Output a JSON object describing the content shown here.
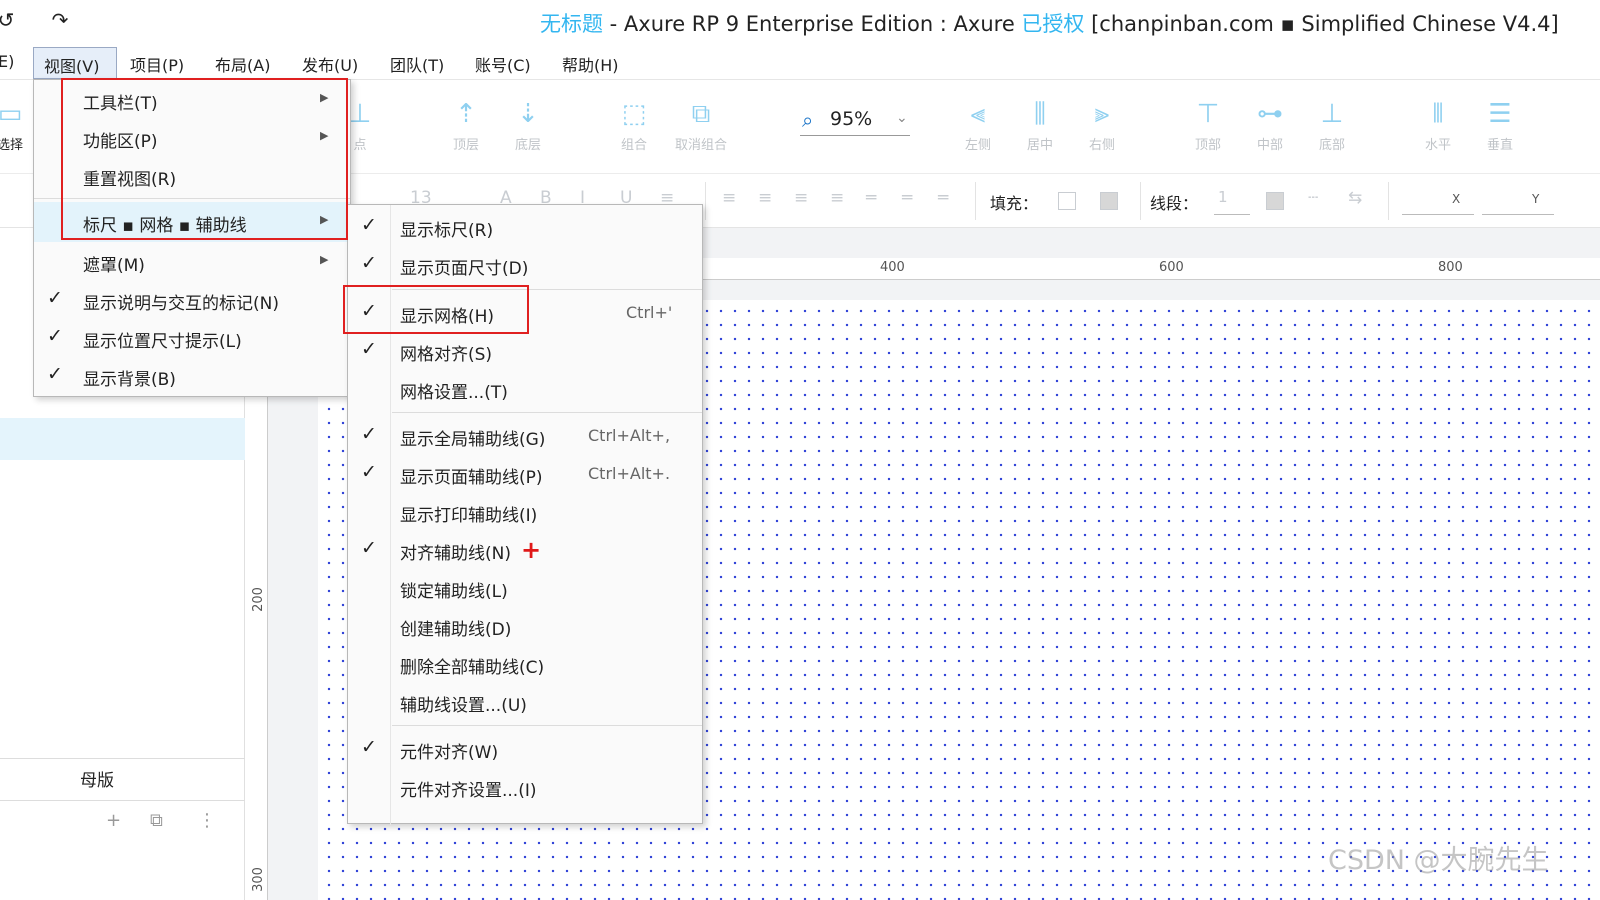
{
  "titlebar": {
    "undo_icon": "undo-icon",
    "redo_icon": "redo-icon",
    "title_name": "无标题",
    "title_mid": " - Axure RP 9 Enterprise Edition : Axure ",
    "title_licensed": "已授权",
    "title_tail": " [chanpinban.com ▪ Simplified Chinese V4.4]",
    "accent_color": "#33b6f0"
  },
  "menubar": {
    "edit_partial": "E)",
    "view": "视图(V)",
    "project": "项目(P)",
    "layout": "布局(A)",
    "publish": "发布(U)",
    "team": "团队(T)",
    "account": "账号(C)",
    "help": "帮助(H)"
  },
  "toolbar": {
    "select_label": "选择",
    "end_label": "点",
    "top_layer": "顶层",
    "bottom_layer": "底层",
    "group": "组合",
    "ungroup": "取消组合",
    "zoom_value": "95%",
    "align_left": "左侧",
    "align_center": "居中",
    "align_right": "右侧",
    "align_top": "顶部",
    "align_middle": "中部",
    "align_bottom": "底部",
    "distribute_h": "水平",
    "distribute_v": "垂直"
  },
  "stylebar": {
    "font_size": "13",
    "fill_label": "填充：",
    "stroke_label": "线段：",
    "stroke_value": "1",
    "x_label": "X",
    "y_label": "Y"
  },
  "leftpanel": {
    "masters_label": "母版"
  },
  "rulers": {
    "h400": "400",
    "h600": "600",
    "h800": "800",
    "v200": "200",
    "v300": "300"
  },
  "view_menu": {
    "items": [
      {
        "label": "工具栏(T)",
        "checked": false,
        "submenu": true
      },
      {
        "label": "功能区(P)",
        "checked": false,
        "submenu": true
      },
      {
        "label": "重置视图(R)",
        "checked": false,
        "submenu": false
      },
      {
        "label": "标尺 ▪ 网格 ▪ 辅助线",
        "checked": false,
        "submenu": true
      },
      {
        "label": "遮罩(M)",
        "checked": false,
        "submenu": true
      },
      {
        "label": "显示说明与交互的标记(N)",
        "checked": true,
        "submenu": false
      },
      {
        "label": "显示位置尺寸提示(L)",
        "checked": true,
        "submenu": false
      },
      {
        "label": "显示背景(B)",
        "checked": true,
        "submenu": false
      }
    ]
  },
  "grid_submenu": {
    "items": [
      {
        "label": "显示标尺(R)",
        "checked": true,
        "shortcut": ""
      },
      {
        "label": "显示页面尺寸(D)",
        "checked": true,
        "shortcut": ""
      },
      {
        "label": "显示网格(H)",
        "checked": true,
        "shortcut": "Ctrl+'"
      },
      {
        "label": "网格对齐(S)",
        "checked": true,
        "shortcut": ""
      },
      {
        "label": "网格设置...(T)",
        "checked": false,
        "shortcut": ""
      },
      {
        "label": "显示全局辅助线(G)",
        "checked": true,
        "shortcut": "Ctrl+Alt+,"
      },
      {
        "label": "显示页面辅助线(P)",
        "checked": true,
        "shortcut": "Ctrl+Alt+."
      },
      {
        "label": "显示打印辅助线(I)",
        "checked": false,
        "shortcut": ""
      },
      {
        "label": "对齐辅助线(N)",
        "checked": true,
        "shortcut": ""
      },
      {
        "label": "锁定辅助线(L)",
        "checked": false,
        "shortcut": ""
      },
      {
        "label": "创建辅助线(D)",
        "checked": false,
        "shortcut": ""
      },
      {
        "label": "删除全部辅助线(C)",
        "checked": false,
        "shortcut": ""
      },
      {
        "label": "辅助线设置...(U)",
        "checked": false,
        "shortcut": ""
      },
      {
        "label": "元件对齐(W)",
        "checked": true,
        "shortcut": ""
      },
      {
        "label": "元件对齐设置...(I)",
        "checked": false,
        "shortcut": ""
      }
    ]
  },
  "annotation_color": "#e02020",
  "watermark": "CSDN @大腕先生"
}
